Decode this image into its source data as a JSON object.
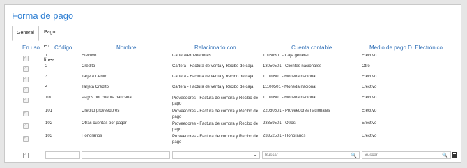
{
  "title": "Forma de pago",
  "tabs": [
    {
      "label": "General"
    },
    {
      "label": "Pago en línea"
    }
  ],
  "headers": {
    "en_uso": "En uso",
    "codigo": "Código",
    "nombre": "Nombre",
    "relacionado": "Relacionado con",
    "cuenta": "Cuenta contable",
    "medio": "Medio de pago D. Electrónico"
  },
  "rows": [
    {
      "codigo": "1",
      "nombre": "Efectivo",
      "relacionado": "Cartera/Proveedores",
      "cuenta": "11050501 - Caja general",
      "medio": "Efectivo"
    },
    {
      "codigo": "2",
      "nombre": "Crédito",
      "relacionado": "Cartera - Factura de venta y Recibo de caja",
      "cuenta": "13050501 - Clientes nacionales",
      "medio": "Otro"
    },
    {
      "codigo": "3",
      "nombre": "Tarjeta Débito",
      "relacionado": "Cartera - Factura de venta y Recibo de caja",
      "cuenta": "11100501 - Moneda nacional",
      "medio": "Efectivo"
    },
    {
      "codigo": "4",
      "nombre": "Tarjeta Crédito",
      "relacionado": "Cartera - Factura de venta y Recibo de caja",
      "cuenta": "11100501 - Moneda nacional",
      "medio": "Efectivo"
    },
    {
      "codigo": "100",
      "nombre": "Pagos por cuenta bancaria",
      "relacionado": "Proveedores - Factura de compra y Recibo de pago",
      "cuenta": "11100501 - Moneda nacional",
      "medio": "Efectivo"
    },
    {
      "codigo": "101",
      "nombre": "Crédito proveedores",
      "relacionado": "Proveedores - Factura de compra y Recibo de pago",
      "cuenta": "22050501 - Proveedores nacionales",
      "medio": "Efectivo"
    },
    {
      "codigo": "102",
      "nombre": "Otras cuentas por pagar",
      "relacionado": "Proveedores - Factura de compra y Recibo de pago",
      "cuenta": "23359501 - Otros",
      "medio": "Efectivo"
    },
    {
      "codigo": "103",
      "nombre": "Honorarios",
      "relacionado": "Proveedores - Factura de compra y Recibo de pago",
      "cuenta": "23352501 - Honorarios",
      "medio": "Efectivo"
    }
  ],
  "footer": {
    "cuenta_placeholder": "Buscar",
    "medio_placeholder": "Buscar"
  },
  "icons": {
    "search": "search-icon",
    "save": "save-icon",
    "chevron": "chevron-down-icon",
    "checkbox": "checkbox-icon"
  },
  "colors": {
    "accent": "#2f7fd3",
    "header": "#2f6fb7"
  }
}
